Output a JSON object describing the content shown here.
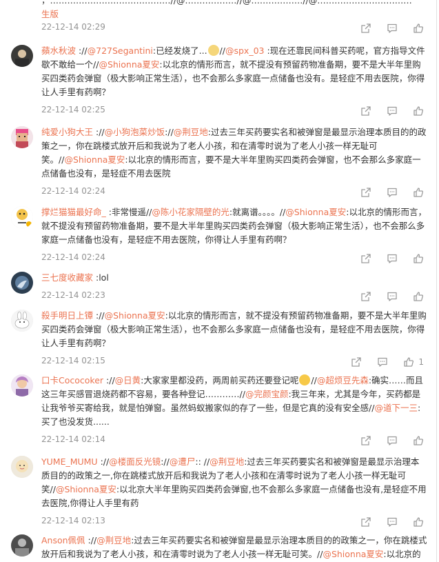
{
  "top_comment": {
    "text_visible": "，……………………………………//@………………//@………………//@……………………………",
    "text_line2": "生版",
    "time": "22-12-14 02:29"
  },
  "comments": [
    {
      "user": "蘋水秋波",
      "parts": [
        {
          "t": " ://"
        },
        {
          "m": "@727Segantini"
        },
        {
          "t": ":已经发烧了..."
        },
        {
          "e": "cat"
        },
        {
          "t": "//"
        },
        {
          "m": "@spx_03"
        },
        {
          "t": " :现在还靠民间科普买药呢，官方指导文件歇不敢给一个//"
        },
        {
          "m": "@Shionna夏安"
        },
        {
          "t": ":以北京的情形而言，就不提没有预留药物准备期，要不是大半年里购买四类药会弹窗（极大影响正常生活），也不会那么多家庭一点储备也没有。是轻症不用去医院，你得让人手里有药啊？"
        }
      ],
      "time": "22-12-14 02:25",
      "likes": ""
    },
    {
      "user": "纯爱小狗大王",
      "parts": [
        {
          "t": " ://"
        },
        {
          "m": "@小狗泡菜炒饭"
        },
        {
          "t": "://"
        },
        {
          "m": "@荆豆地"
        },
        {
          "t": ":过去三年买药要实名和被弹窗是最显示治理本质目的的政策之一，你在跳楼式放开后和我说为了老人小孩，和在清零时说为了老人小孩一样无耻可笑。//"
        },
        {
          "m": "@Shionna夏安"
        },
        {
          "t": ":以北京的情形而言，要不是大半年里购买四类药会弹窗，也不会那么多家庭一点储备也没有，是轻症不用去医院"
        }
      ],
      "time": "22-12-14 02:24",
      "likes": ""
    },
    {
      "user": "撑烂猫猫最好命_",
      "parts": [
        {
          "t": " :非常慢遥//"
        },
        {
          "m": "@陈小花家隔壁的光"
        },
        {
          "t": ":就离谱。。。。//"
        },
        {
          "m": "@Shionna夏安"
        },
        {
          "t": ":以北京的情形而言，就不提没有预留药物准备期，要不是大半年里购买四类药会弹窗（极大影响正常生活），也不会那么多家庭一点储备也没有，是轻症不用去医院，你得让人手里有药啊？"
        }
      ],
      "time": "22-12-14 02:24",
      "likes": ""
    },
    {
      "user": "三七度收藏家",
      "parts": [
        {
          "t": " :lol"
        }
      ],
      "time": "22-12-14 02:23",
      "likes": ""
    },
    {
      "user": "殺手明日上镡",
      "parts": [
        {
          "t": " ://"
        },
        {
          "m": "@Shionna夏安"
        },
        {
          "t": ":以北京的情形而言，就不提没有预留药物准备期，要不是大半年里购买四类药会弹窗（极大影响正常生活），也不会那么多家庭一点储备也没有，是轻症不用去医院，你得让人手里有药啊？"
        }
      ],
      "time": "22-12-14 02:15",
      "likes": "1"
    },
    {
      "user": "口卡Cococoker",
      "parts": [
        {
          "t": " ://"
        },
        {
          "m": "@日黄"
        },
        {
          "t": ":大家家里都没药，两周前买药还要登记呢"
        },
        {
          "e": "laugh"
        },
        {
          "t": "//"
        },
        {
          "m": "@超烦豆先森"
        },
        {
          "t": ":确实……而且这三年买感冒退烧药都不容易，要各种登记…………//"
        },
        {
          "m": "@完颜宝颜"
        },
        {
          "t": ":我三年来，尤其是今年，买药都是让我爷爷买寄给我，就是怕弹窗。虽然蚂蚁搬家似的存了一些，但是它真的没有安全感//"
        },
        {
          "m": "@道下一三"
        },
        {
          "t": ":买了也没发货......"
        }
      ],
      "time": "22-12-14 02:14",
      "likes": ""
    },
    {
      "user": "YUME_MUMU",
      "parts": [
        {
          "t": " ://"
        },
        {
          "m": "@楼面反光镜"
        },
        {
          "t": "://"
        },
        {
          "m": "@遭尸"
        },
        {
          "t": ":: //"
        },
        {
          "m": "@荆豆地"
        },
        {
          "t": ":过去三年买药要实名和被弹窗是最显示治理本质目的的政策之一,你在跳楼式放开后和我说为了老人小孩和在清零时说为了老人小孩一样无耻可笑//"
        },
        {
          "m": "@Shionna夏安"
        },
        {
          "t": ":以北京大半年里购买四类药会弹窗,也不会那么多家庭一点储备也没有,是轻症不用去医院,你得让人手里有药"
        }
      ],
      "time": "22-12-14 02:13",
      "likes": ""
    },
    {
      "user": "Anson佩佩",
      "parts": [
        {
          "t": " ://"
        },
        {
          "m": "@荆豆地"
        },
        {
          "t": ":过去三年买药要实名和被弹窗是最显示治理本质目的的政策之一，你在跳楼式放开后和我说为了老人小孩，和在清零时说为了老人小孩一样无耻可笑。//"
        },
        {
          "m": "@Shionna夏安"
        },
        {
          "t": ":以北京的情形而"
        }
      ],
      "time": "",
      "likes": ""
    }
  ],
  "colors": {
    "accent": "#eb7350",
    "meta": "#939393",
    "text": "#333333"
  },
  "icons": [
    "share-icon",
    "comment-icon",
    "like-icon"
  ]
}
